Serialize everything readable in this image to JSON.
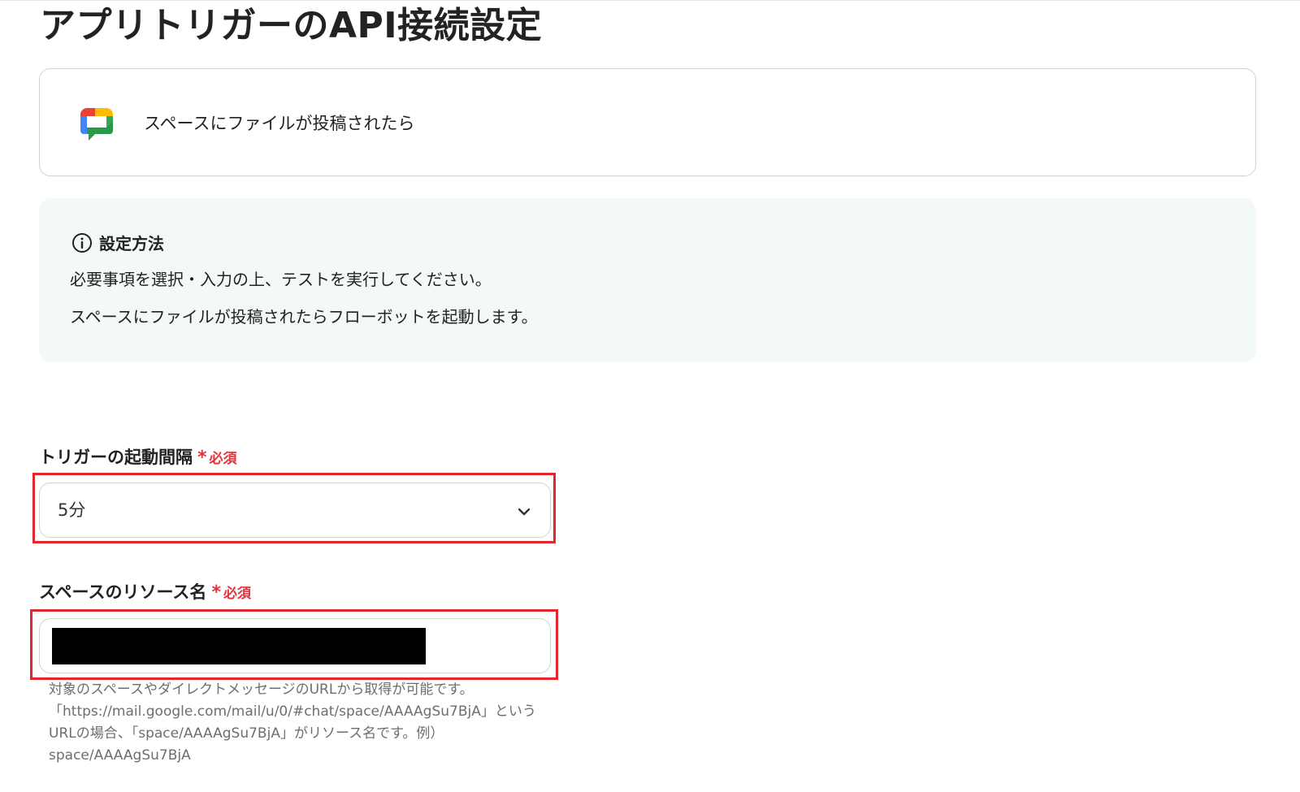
{
  "page": {
    "title": "アプリトリガーのAPI接続設定"
  },
  "trigger": {
    "app_icon": "google-chat-icon",
    "label": "スペースにファイルが投稿されたら"
  },
  "info": {
    "icon": "info-circle-icon",
    "heading": "設定方法",
    "lines": [
      "必要事項を選択・入力の上、テストを実行してください。",
      "スペースにファイルが投稿されたらフローボットを起動します。"
    ]
  },
  "fields": {
    "interval": {
      "label": "トリガーの起動間隔",
      "required_mark": "*",
      "required_text": "必須",
      "selected_value": "5分"
    },
    "space_resource": {
      "label": "スペースのリソース名",
      "required_mark": "*",
      "required_text": "必須",
      "value_redacted": true,
      "help_lines": [
        "対象のスペースやダイレクトメッセージのURLから取得が可能です。",
        "「https://mail.google.com/mail/u/0/#chat/space/AAAAgSu7BjA」という",
        "URLの場合、「space/AAAAgSu7BjA」がリソース名です。例）",
        "space/AAAAgSu7BjA"
      ]
    }
  },
  "colors": {
    "highlight": "#e3262e",
    "required": "#e5323a",
    "info_background": "#f2f9f8",
    "border": "#cfd3d6"
  }
}
